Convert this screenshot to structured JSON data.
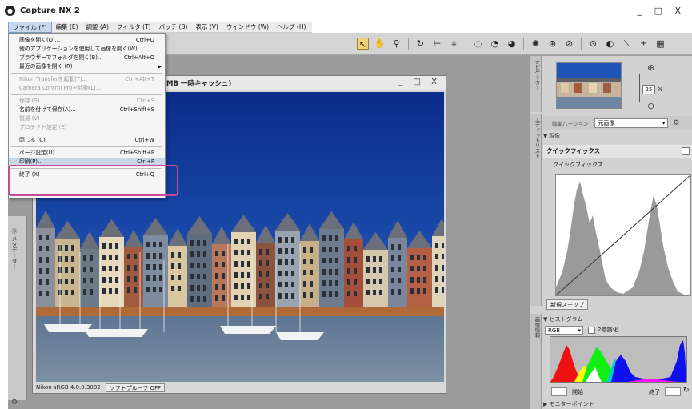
{
  "window": {
    "title": "Capture NX 2",
    "controls": "_ □ X"
  },
  "menubar": {
    "items": [
      "ファイル (F)",
      "編集 (E)",
      "調整 (A)",
      "フィルタ (T)",
      "バッチ (B)",
      "表示 (V)",
      "ウィンドウ (W)",
      "ヘルプ (H)"
    ],
    "active_index": 0
  },
  "file_menu": {
    "items": [
      {
        "label": "画像を開く(O)...",
        "shortcut": "Ctrl+O",
        "disabled": false
      },
      {
        "label": "他のアプリケーションを使用して画像を開く(W)...",
        "shortcut": "",
        "disabled": false
      },
      {
        "label": "ブラウザーでフォルダを開く(B)...",
        "shortcut": "Ctrl+Alt+O",
        "disabled": false
      },
      {
        "label": "最近の画像を開く (R)",
        "shortcut": "",
        "disabled": false,
        "submenu": true
      },
      {
        "sep": true
      },
      {
        "label": "Nikon Transferを起動(T)...",
        "shortcut": "Ctrl+Alt+T",
        "disabled": true
      },
      {
        "label": "Camera Control Proを起動(L)...",
        "shortcut": "",
        "disabled": true
      },
      {
        "sep": true
      },
      {
        "label": "保存 (S)",
        "shortcut": "Ctrl+S",
        "disabled": true
      },
      {
        "label": "名前を付けて保存(A)...",
        "shortcut": "Ctrl+Shift+S",
        "disabled": false
      },
      {
        "label": "復帰 (V)",
        "shortcut": "",
        "disabled": true
      },
      {
        "label": "プロテクト設定 (E)",
        "shortcut": "",
        "disabled": true
      },
      {
        "sep": true
      },
      {
        "label": "閉じる (C)",
        "shortcut": "Ctrl+W",
        "disabled": false
      },
      {
        "sep": true
      },
      {
        "label": "ページ設定(U)...",
        "shortcut": "Ctrl+Shift+P",
        "disabled": false
      },
      {
        "label": "印刷(P)...",
        "shortcut": "Ctrl+P",
        "disabled": false,
        "highlight": true
      },
      {
        "sep": true
      },
      {
        "label": "終了 (X)",
        "shortcut": "Ctrl+Q",
        "disabled": false
      }
    ]
  },
  "document": {
    "title": "MB 一時キャッシュ)",
    "status_profile": "Nikon sRGB 4.0.0.3002",
    "proof_button": "ソフトプルーフ OFF"
  },
  "toolbar": {
    "tools": [
      "select-arrow",
      "hand",
      "zoom",
      "rotate",
      "straighten",
      "crop",
      "red-eye",
      "dodge",
      "burn",
      "color-control-point",
      "auto-retouch",
      "lasso",
      "selection-control-point",
      "gradient",
      "plus-minus",
      "levels"
    ]
  },
  "left_panel": {
    "tab_label": "Ⓓ メタデーター"
  },
  "navigator": {
    "tab_label": "ナビゲーター",
    "zoom_value": "25",
    "zoom_unit": "%"
  },
  "edit_list": {
    "tab_label": "エディットリスト",
    "version_label": "編集バージョン",
    "version_value": "元画像",
    "history_label": "▼ 現像"
  },
  "quick_fix": {
    "header": "クイックフィックス",
    "sub_label": "クイックフィックス",
    "new_step_button": "新規ステップ"
  },
  "histogram_panel": {
    "tab_label": "画像情報",
    "header": "▼ ヒストグラム",
    "channel_value": "RGB",
    "tone_label": "2階調化",
    "start_label": "開始",
    "end_label": "終了",
    "color_point_header": "▶ モニターポイント"
  },
  "colors": {
    "accent_highlight": "#c44a98",
    "menu_highlight": "#c9d6e6",
    "panel_bg": "#d2d2d2",
    "app_bg": "#9b9b9b"
  }
}
